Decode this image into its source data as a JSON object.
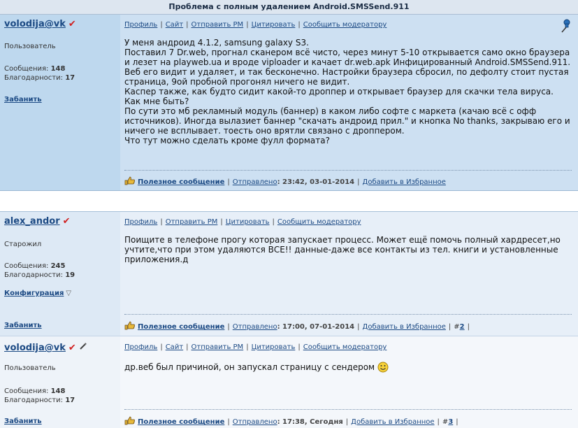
{
  "page_title": "Проблема с полным удалением Android.SMSSend.911",
  "posts": [
    {
      "username": "volodija@vk",
      "user_mark": "✔",
      "rank": "Пользователь",
      "messages_label": "Сообщения:",
      "messages_count": "148",
      "thanks_label": "Благодарности:",
      "thanks_count": "17",
      "ban_link": "Забанить",
      "top_links": [
        "Профиль",
        "Сайт",
        "Отправить PM",
        "Цитировать",
        "Сообщить модератору"
      ],
      "body": "У меня андроид 4.1.2, samsung galaxy S3.\nПоставил 7 Dr.web, прогнал сканером всё чисто, через минут 5-10 открывается само окно браузера и лезет на playweb.ua и вроде viploader и качает dr.web.apk Инфицированный Android.SMSSend.911.\nВеб его видит и удаляет, и так бесконечно. Настройки браузера сбросил, по дефолту стоит пустая страница, 9ой пробной прогонял ничего не видит.\nКаспер также, как будто сидит какой-то дроппер и открывает браузер для скачки тела вируса. Как мне быть?\nПо сути это мб рекламный модуль (баннер) в каком либо софте с маркета (качаю всё с офф источников). Иногда вылазиет баннер \"скачать андроид прил.\" и кнопка No thanks, закрываю его и ничего не всплывает. тоесть оно врятли связано с дроппером.\nЧто тут можно сделать кроме фулл формата?",
      "useful_label": "Полезное сообщение",
      "sent_label": "Отправлено",
      "sent_time": ": 23:42, 03-01-2014",
      "favorite_label": "Добавить в Избранное"
    },
    {
      "username": "alex_andor",
      "user_mark": "✔",
      "rank": "Старожил",
      "messages_label": "Сообщения:",
      "messages_count": "245",
      "thanks_label": "Благодарности:",
      "thanks_count": "19",
      "config_link": "Конфигурация",
      "ban_link": "Забанить",
      "top_links": [
        "Профиль",
        "Отправить PM",
        "Цитировать",
        "Сообщить модератору"
      ],
      "body": "Поищите в телефоне прогу которая запускает процесс. Может ещё помочь полный хардресет,но учтите,что при этом удаляются ВСЕ!! данные-даже все контакты из тел. книги и установленные приложения.д",
      "useful_label": "Полезное сообщение",
      "sent_label": "Отправлено",
      "sent_time": ": 17:00, 07-01-2014",
      "favorite_label": "Добавить в Избранное",
      "post_num_prefix": "#",
      "post_num": "2"
    },
    {
      "username": "volodija@vk",
      "user_mark": "✔",
      "rank": "Пользователь",
      "messages_label": "Сообщения:",
      "messages_count": "148",
      "thanks_label": "Благодарности:",
      "thanks_count": "17",
      "ban_link": "Забанить",
      "top_links": [
        "Профиль",
        "Сайт",
        "Отправить PM",
        "Цитировать",
        "Сообщить модератору"
      ],
      "body": "др.веб был причиной, он запускал страницу с сендером",
      "useful_label": "Полезное сообщение",
      "sent_label": "Отправлено",
      "sent_time": ": 17:38, Сегодня",
      "favorite_label": "Добавить в Избранное",
      "post_num_prefix": "#",
      "post_num": "3"
    }
  ],
  "colors": {
    "link": "#1c4a84",
    "post1_bg": "#cde0f2",
    "post2_bg": "#e7eff8",
    "post3_bg": "#f4f7fb",
    "title_bar": "#dde6f0"
  },
  "icons": [
    "check-mark-icon",
    "pin-icon",
    "thumbs-up-icon",
    "smiley-icon",
    "pen-icon",
    "dropdown-triangle-icon"
  ]
}
